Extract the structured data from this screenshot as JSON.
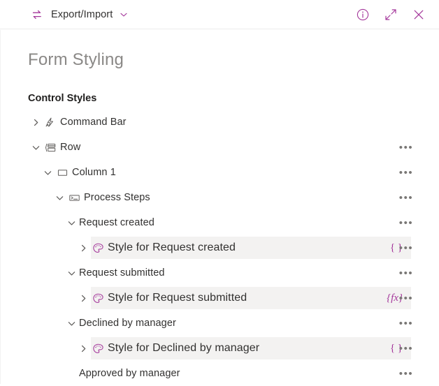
{
  "header": {
    "swap_icon": "swap-arrows-icon",
    "menu_label": "Export/Import",
    "chevron_icon": "chevron-down-icon",
    "info_icon": "info-circle-icon",
    "expand_icon": "expand-diagonal-icon",
    "close_icon": "close-icon",
    "accent_color": "#a4379b"
  },
  "page": {
    "title": "Form Styling",
    "section_title": "Control Styles"
  },
  "overflow_label": "•••",
  "tree": [
    {
      "label": "Command Bar",
      "depth": 0,
      "state": "collapsed",
      "icon": "command-bar-icon",
      "style_row": false,
      "badge": "",
      "overflow": false
    },
    {
      "label": "Row",
      "depth": 0,
      "state": "expanded",
      "icon": "row-layout-icon",
      "style_row": false,
      "badge": "",
      "overflow": true
    },
    {
      "label": "Column 1",
      "depth": 1,
      "state": "expanded",
      "icon": "column-icon",
      "style_row": false,
      "badge": "",
      "overflow": true
    },
    {
      "label": "Process Steps",
      "depth": 2,
      "state": "expanded",
      "icon": "process-steps-icon",
      "style_row": false,
      "badge": "",
      "overflow": true
    },
    {
      "label": "Request created",
      "depth": 3,
      "state": "expanded",
      "icon": "",
      "style_row": false,
      "badge": "",
      "overflow": true
    },
    {
      "label": "Style for Request created",
      "depth": 4,
      "state": "collapsed",
      "icon": "palette-icon",
      "style_row": true,
      "badge": "{ }",
      "badge_kind": "plain",
      "overflow": true
    },
    {
      "label": "Request submitted",
      "depth": 3,
      "state": "expanded",
      "icon": "",
      "style_row": false,
      "badge": "",
      "overflow": true
    },
    {
      "label": "Style for Request submitted",
      "depth": 4,
      "state": "collapsed",
      "icon": "palette-icon",
      "style_row": true,
      "badge": "{fx}",
      "badge_kind": "italic",
      "overflow": true
    },
    {
      "label": "Declined by manager",
      "depth": 3,
      "state": "expanded",
      "icon": "",
      "style_row": false,
      "badge": "",
      "overflow": true
    },
    {
      "label": "Style for Declined by manager",
      "depth": 4,
      "state": "collapsed",
      "icon": "palette-icon",
      "style_row": true,
      "badge": "{ }",
      "badge_kind": "plain",
      "overflow": true
    },
    {
      "label": "Approved by manager",
      "depth": 3,
      "state": "leaf",
      "icon": "",
      "style_row": false,
      "badge": "",
      "overflow": true
    }
  ]
}
